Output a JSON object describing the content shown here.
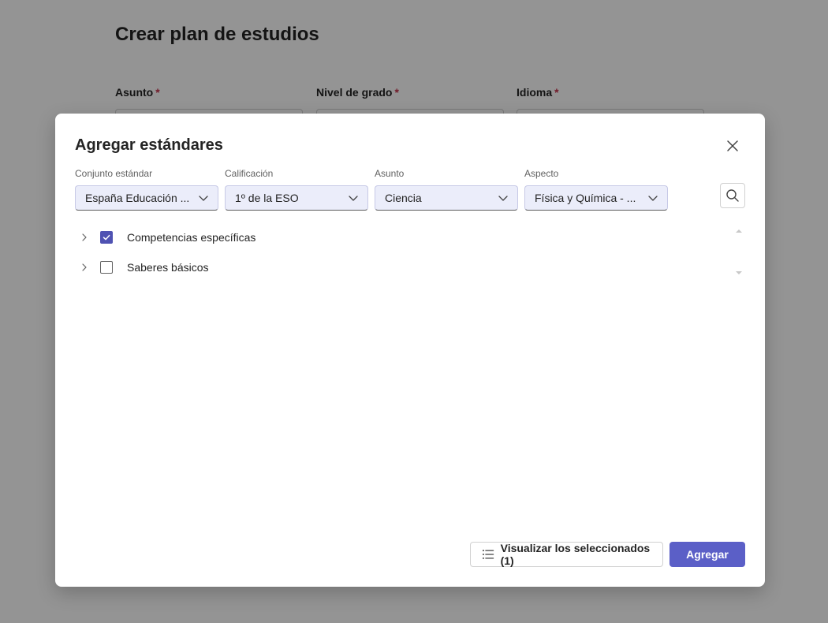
{
  "background_page": {
    "title": "Crear plan de estudios",
    "required_mark": "*",
    "fields": [
      {
        "label": "Asunto"
      },
      {
        "label": "Nivel de grado"
      },
      {
        "label": "Idioma"
      }
    ]
  },
  "dialog": {
    "title": "Agregar estándares",
    "filters": [
      {
        "label": "Conjunto estándar",
        "value": "España Educación ..."
      },
      {
        "label": "Calificación",
        "value": "1º de la ESO"
      },
      {
        "label": "Asunto",
        "value": "Ciencia"
      },
      {
        "label": "Aspecto",
        "value": "Física y Química - ..."
      }
    ],
    "tree": [
      {
        "label": "Competencias específicas",
        "checked": true
      },
      {
        "label": "Saberes básicos",
        "checked": false
      }
    ],
    "footer": {
      "view_selected_label": "Visualizar los seleccionados (1)",
      "add_label": "Agregar"
    }
  },
  "colors": {
    "accent": "#5b5fc7",
    "select_bg": "#ebedfa",
    "required": "#c4314b"
  },
  "icons": {
    "close": "close-icon",
    "chevron": "chevron-down-icon",
    "search": "search-icon",
    "expand": "chevron-right-icon",
    "list": "list-icon"
  }
}
